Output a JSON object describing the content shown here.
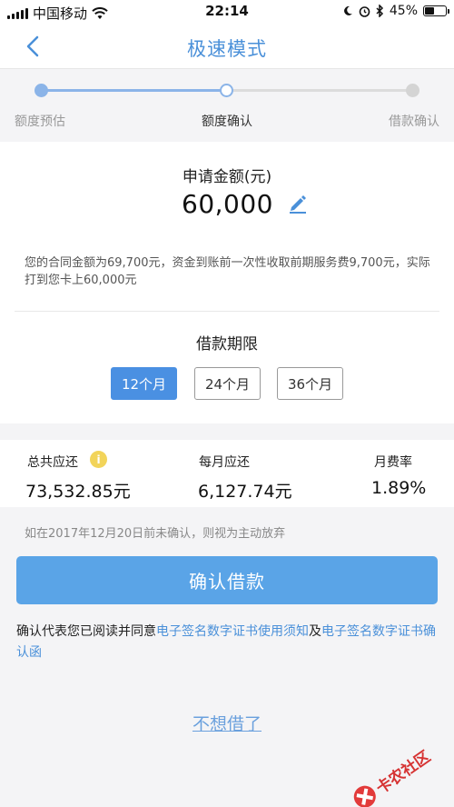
{
  "status_bar": {
    "carrier": "中国移动",
    "time": "22:14",
    "battery": "45%"
  },
  "nav": {
    "title": "极速模式"
  },
  "steps": [
    {
      "label": "额度预估",
      "state": "done"
    },
    {
      "label": "额度确认",
      "state": "current"
    },
    {
      "label": "借款确认",
      "state": "pending"
    }
  ],
  "loan": {
    "amount_label": "申请金额(元)",
    "amount_value": "60,000",
    "contract_note": "您的合同金额为69,700元，资金到账前一次性收取前期服务费9,700元，实际打到您卡上60,000元"
  },
  "term": {
    "title": "借款期限",
    "options": [
      "12个月",
      "24个月",
      "36个月"
    ],
    "selected": "12个月"
  },
  "summary": {
    "total_label": "总共应还",
    "total_value": "73,532.85元",
    "monthly_label": "每月应还",
    "monthly_value": "6,127.74元",
    "rate_label": "月费率",
    "rate_value": "1.89%"
  },
  "deadline_note": "如在2017年12月20日前未确认，则视为主动放弃",
  "confirm_button": "确认借款",
  "agreement": {
    "prefix": "确认代表您已阅读并同意",
    "link1": "电子签名数字证书使用须知",
    "joiner": "及",
    "link2": "电子签名数字证书确认函"
  },
  "decline_link": "不想借了",
  "watermark": "卡农社区",
  "colors": {
    "accent": "#4a90e2",
    "button": "#5aa4e7",
    "link": "#4a90d9",
    "info": "#f2d45a",
    "watermark": "#d63333"
  }
}
